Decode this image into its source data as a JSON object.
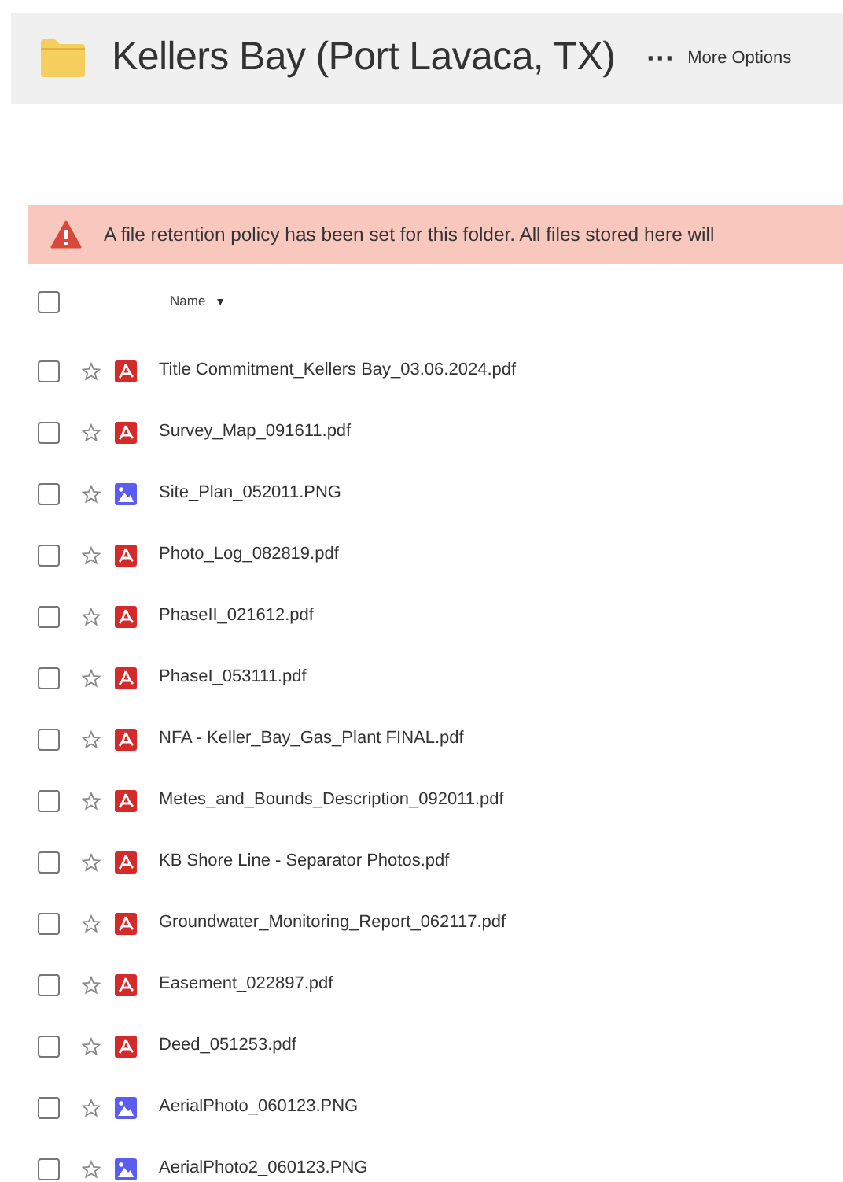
{
  "header": {
    "title": "Kellers Bay (Port Lavaca, TX)",
    "more_dots": "···",
    "more_label": "More Options"
  },
  "banner": {
    "text": "A file retention policy has been set for this folder. All files stored here will"
  },
  "table": {
    "select_all_checked": false,
    "name_column": "Name",
    "sort_mark": "▼",
    "rows": [
      {
        "name": "Title Commitment_Kellers Bay_03.06.2024.pdf",
        "kind": "pdf",
        "checked": false,
        "starred": false
      },
      {
        "name": "Survey_Map_091611.pdf",
        "kind": "pdf",
        "checked": false,
        "starred": false
      },
      {
        "name": "Site_Plan_052011.PNG",
        "kind": "image",
        "checked": false,
        "starred": false
      },
      {
        "name": "Photo_Log_082819.pdf",
        "kind": "pdf",
        "checked": false,
        "starred": false
      },
      {
        "name": "PhaseII_021612.pdf",
        "kind": "pdf",
        "checked": false,
        "starred": false
      },
      {
        "name": "PhaseI_053111.pdf",
        "kind": "pdf",
        "checked": false,
        "starred": false
      },
      {
        "name": "NFA - Keller_Bay_Gas_Plant FINAL.pdf",
        "kind": "pdf",
        "checked": false,
        "starred": false
      },
      {
        "name": "Metes_and_Bounds_Description_092011.pdf",
        "kind": "pdf",
        "checked": false,
        "starred": false
      },
      {
        "name": "KB Shore Line - Separator Photos.pdf",
        "kind": "pdf",
        "checked": false,
        "starred": false
      },
      {
        "name": "Groundwater_Monitoring_Report_062117.pdf",
        "kind": "pdf",
        "checked": false,
        "starred": false
      },
      {
        "name": "Easement_022897.pdf",
        "kind": "pdf",
        "checked": false,
        "starred": false
      },
      {
        "name": "Deed_051253.pdf",
        "kind": "pdf",
        "checked": false,
        "starred": false
      },
      {
        "name": "AerialPhoto_060123.PNG",
        "kind": "image",
        "checked": false,
        "starred": false
      },
      {
        "name": "AerialPhoto2_060123.PNG",
        "kind": "image",
        "checked": false,
        "starred": false
      }
    ]
  }
}
